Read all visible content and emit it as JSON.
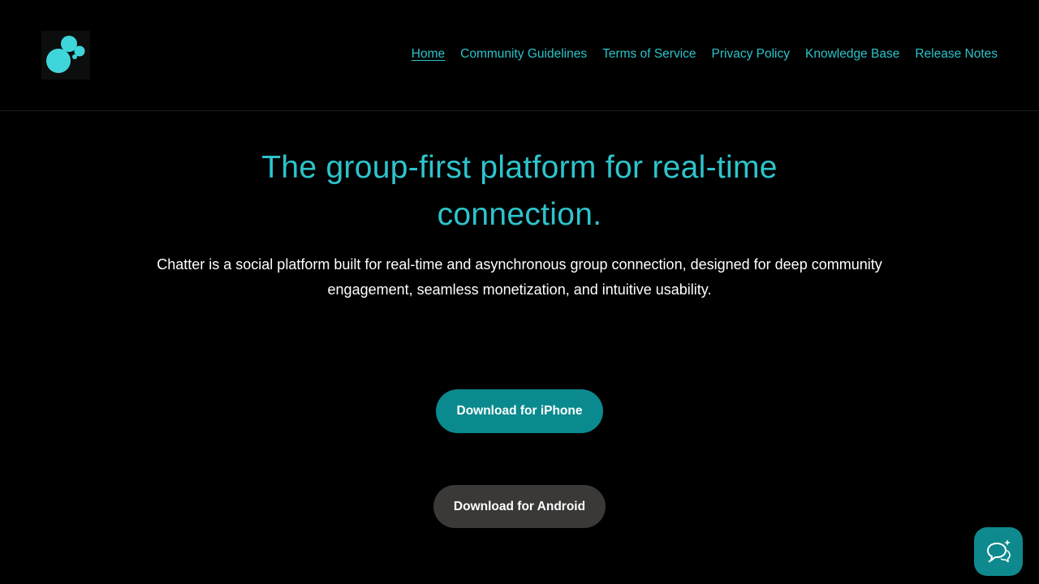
{
  "nav": {
    "items": [
      {
        "label": "Home"
      },
      {
        "label": "Community Guidelines"
      },
      {
        "label": "Terms of Service"
      },
      {
        "label": "Privacy Policy"
      },
      {
        "label": "Knowledge Base"
      },
      {
        "label": "Release Notes"
      }
    ],
    "active": "Home"
  },
  "hero": {
    "title": "The group-first platform for real-time connection.",
    "description": "Chatter is a social platform built for real-time and asynchronous group connection, designed for deep community engagement, seamless monetization, and intuitive usability."
  },
  "buttons": {
    "iphone_label": "Download for iPhone",
    "android_label": "Download for Android"
  },
  "icons": {
    "logo": "bubbles-logo-icon",
    "chat": "chat-support-icon"
  },
  "colors": {
    "accent": "#2cc3c9",
    "primary_button": "#0a8a8e",
    "secondary_button": "#3a3937",
    "background": "#000000",
    "text": "#ffffff"
  }
}
